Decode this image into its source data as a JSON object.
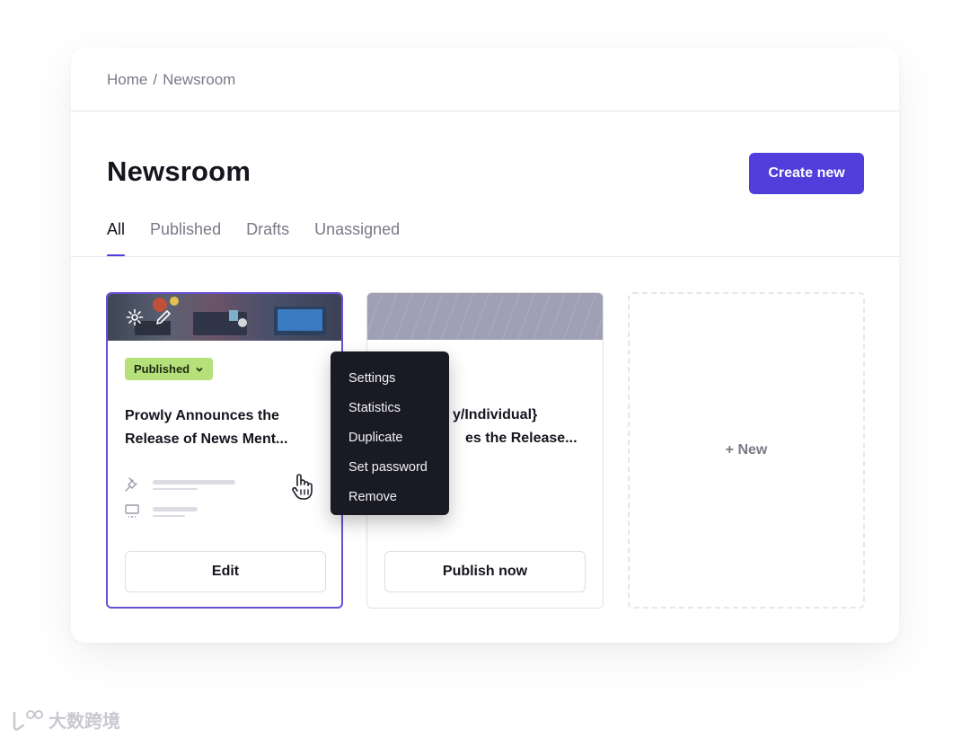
{
  "breadcrumb": {
    "home": "Home",
    "separator": "/",
    "current": "Newsroom"
  },
  "page": {
    "title": "Newsroom",
    "create_button": "Create new"
  },
  "tabs": [
    {
      "label": "All",
      "active": true
    },
    {
      "label": "Published",
      "active": false
    },
    {
      "label": "Drafts",
      "active": false
    },
    {
      "label": "Unassigned",
      "active": false
    }
  ],
  "cards": [
    {
      "status_badge": "Published",
      "title_line1": "Prowly Announces the",
      "title_line2": "Release of News Ment...",
      "button": "Edit",
      "image_icons": [
        "gear-icon",
        "pencil-icon"
      ]
    },
    {
      "title_line1": "y/Individual}",
      "title_line2": "es the Release...",
      "button": "Publish now"
    }
  ],
  "new_card": {
    "label": "+ New"
  },
  "context_menu": {
    "items": [
      "Settings",
      "Statistics",
      "Duplicate",
      "Set password",
      "Remove"
    ]
  },
  "colors": {
    "accent": "#4f3ddc",
    "selected_border": "#6a4fd6",
    "published_badge": "#b6e07a",
    "menu_bg": "#1a1a24"
  },
  "watermark": {
    "text": "大数跨境"
  }
}
